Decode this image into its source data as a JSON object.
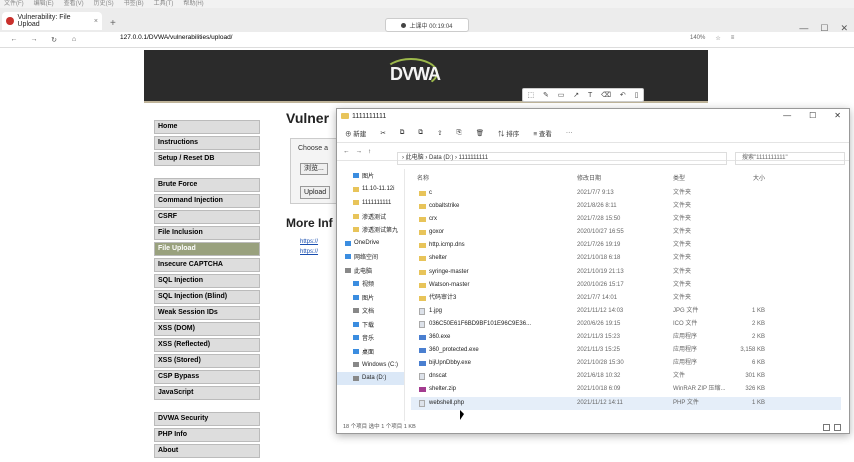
{
  "menubar": [
    "文件(F)",
    "编辑(E)",
    "查看(V)",
    "历史(S)",
    "书签(B)",
    "工具(T)",
    "帮助(H)"
  ],
  "browser": {
    "tab_title": "Vulnerability: File Upload",
    "tab_close": "×",
    "new_tab": "+",
    "recorder_label": "上课中 00:19:04",
    "url": "127.0.0.1/DVWA/vulnerabilities/upload/",
    "zoom": "140%",
    "win_min": "—",
    "win_max": "☐",
    "win_close": "✕"
  },
  "dvwa": {
    "logo": "DVWA",
    "menu": [
      {
        "label": "Home"
      },
      {
        "label": "Instructions"
      },
      {
        "label": "Setup / Reset DB"
      },
      {
        "label": "Brute Force"
      },
      {
        "label": "Command Injection"
      },
      {
        "label": "CSRF"
      },
      {
        "label": "File Inclusion"
      },
      {
        "label": "File Upload"
      },
      {
        "label": "Insecure CAPTCHA"
      },
      {
        "label": "SQL Injection"
      },
      {
        "label": "SQL Injection (Blind)"
      },
      {
        "label": "Weak Session IDs"
      },
      {
        "label": "XSS (DOM)"
      },
      {
        "label": "XSS (Reflected)"
      },
      {
        "label": "XSS (Stored)"
      },
      {
        "label": "CSP Bypass"
      },
      {
        "label": "JavaScript"
      },
      {
        "label": "DVWA Security"
      },
      {
        "label": "PHP Info"
      },
      {
        "label": "About"
      }
    ],
    "page_title": "Vulner",
    "choose_label": "Choose a",
    "browse_label": "浏览...",
    "upload_label": "Upload",
    "more_info": "More Inf",
    "links": [
      "h​ttps://",
      "h​ttps://"
    ]
  },
  "explorer": {
    "title": "1111111111",
    "win_min": "—",
    "win_max": "☐",
    "win_close": "✕",
    "toolbar": [
      "⊕ 新建",
      "✂",
      "⧉",
      "⧉",
      "⇪",
      "⎘",
      "🗑",
      "⇅ 排序",
      "≡ 查看",
      "···"
    ],
    "address": "› 此电脑 › Data (D:) › 1111111111",
    "search_placeholder": "搜索\"1111111111\"",
    "nav": [
      {
        "label": "图片",
        "ico": "blue",
        "ind": false
      },
      {
        "label": "11.10-11.12i",
        "ico": "",
        "ind": false
      },
      {
        "label": "1111111111",
        "ico": "",
        "ind": false
      },
      {
        "label": "渗透测试",
        "ico": "",
        "ind": false
      },
      {
        "label": "渗透测试第九",
        "ico": "",
        "ind": false
      },
      {
        "label": "OneDrive",
        "ico": "blue",
        "ind": true
      },
      {
        "label": "网络空间",
        "ico": "blue",
        "ind": true
      },
      {
        "label": "此电脑",
        "ico": "grey",
        "ind": true
      },
      {
        "label": "视频",
        "ico": "blue",
        "ind": false
      },
      {
        "label": "图片",
        "ico": "blue",
        "ind": false
      },
      {
        "label": "文档",
        "ico": "grey",
        "ind": false
      },
      {
        "label": "下载",
        "ico": "blue",
        "ind": false
      },
      {
        "label": "音乐",
        "ico": "blue",
        "ind": false
      },
      {
        "label": "桌面",
        "ico": "blue",
        "ind": false
      },
      {
        "label": "Windows (C:)",
        "ico": "grey",
        "ind": false
      },
      {
        "label": "Data (D:)",
        "ico": "grey",
        "ind": false,
        "sel": true
      }
    ],
    "columns": {
      "name": "名称",
      "date": "修改日期",
      "type": "类型",
      "size": "大小"
    },
    "files": [
      {
        "name": "c",
        "date": "2021/7/7 9:13",
        "type": "文件夹",
        "size": "",
        "kind": "folder"
      },
      {
        "name": "cobaltstrike",
        "date": "2021/8/26 8:11",
        "type": "文件夹",
        "size": "",
        "kind": "folder"
      },
      {
        "name": "crx",
        "date": "2021/7/28 15:50",
        "type": "文件夹",
        "size": "",
        "kind": "folder"
      },
      {
        "name": "goxor",
        "date": "2020/10/27 16:55",
        "type": "文件夹",
        "size": "",
        "kind": "folder"
      },
      {
        "name": "http.icmp.dns",
        "date": "2021/7/26 19:19",
        "type": "文件夹",
        "size": "",
        "kind": "folder"
      },
      {
        "name": "shelter",
        "date": "2021/10/18 6:18",
        "type": "文件夹",
        "size": "",
        "kind": "folder"
      },
      {
        "name": "syringe-master",
        "date": "2021/10/19 21:13",
        "type": "文件夹",
        "size": "",
        "kind": "folder"
      },
      {
        "name": "Watson-master",
        "date": "2020/10/26 15:17",
        "type": "文件夹",
        "size": "",
        "kind": "folder"
      },
      {
        "name": "代码审计3",
        "date": "2021/7/7 14:01",
        "type": "文件夹",
        "size": "",
        "kind": "folder"
      },
      {
        "name": "1.jpg",
        "date": "2021/11/12 14:03",
        "type": "JPG 文件",
        "size": "1 KB",
        "kind": "doc"
      },
      {
        "name": "036C50E61F6BD9BF101E96C9E36...",
        "date": "2020/6/26 19:15",
        "type": "ICO 文件",
        "size": "2 KB",
        "kind": "doc"
      },
      {
        "name": "360.exe",
        "date": "2021/11/3 15:23",
        "type": "应用程序",
        "size": "2 KB",
        "kind": "exe"
      },
      {
        "name": "360_protected.exe",
        "date": "2021/11/3 15:25",
        "type": "应用程序",
        "size": "3,158 KB",
        "kind": "exe"
      },
      {
        "name": "bijUpnDbby.exe",
        "date": "2021/10/28 15:30",
        "type": "应用程序",
        "size": "6 KB",
        "kind": "exe"
      },
      {
        "name": "dnscat",
        "date": "2021/6/18 10:32",
        "type": "文件",
        "size": "301 KB",
        "kind": "doc"
      },
      {
        "name": "shelter.zip",
        "date": "2021/10/18 6:09",
        "type": "WinRAR ZIP 压缩...",
        "size": "326 KB",
        "kind": "zip"
      },
      {
        "name": "webshell.php",
        "date": "2021/11/12 14:11",
        "type": "PHP 文件",
        "size": "1 KB",
        "kind": "doc",
        "hl": true
      }
    ],
    "status": "18 个项目    选中 1 个项目    1 KB"
  }
}
